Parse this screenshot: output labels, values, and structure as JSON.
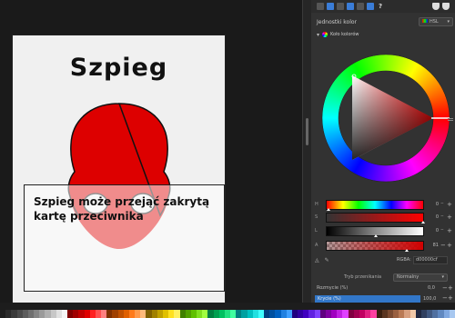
{
  "canvas": {
    "card_title": "Szpieg",
    "card_text": "Szpieg może przejąć zakrytą kartę przeciwnika",
    "spy_color": "#dd0000"
  },
  "dock": {
    "toolbar_icons": [
      "snap-icon",
      "layers-icon",
      "objects-icon",
      "symbols-icon",
      "color-icon",
      "swatches-icon",
      "help-icon",
      "shield-icon",
      "shield-icon"
    ],
    "toolbar_help": "?",
    "units_label": "Jednostki kolor",
    "units_select": "HSL",
    "wheel_header": "Koło kolorów",
    "sliders": [
      {
        "label": "H",
        "value": "0"
      },
      {
        "label": "S",
        "value": "0"
      },
      {
        "label": "L",
        "value": "0"
      },
      {
        "label": "A",
        "value": "81"
      }
    ],
    "rgba_label": "RGBA:",
    "rgba_value": "d00000cf",
    "blend_label": "Tryb przenikania",
    "blend_value": "Normalny",
    "blur_label": "Rozmycie (%)",
    "blur_value": "0,0",
    "opacity_label": "Krycie (%)",
    "opacity_value": "100,0",
    "opacity_fraction": 1.0
  },
  "palette_colors": [
    "#1e1e1e",
    "#2a2a2a",
    "#3a3a3a",
    "#4a4a4a",
    "#5c5c5c",
    "#707070",
    "#858585",
    "#9a9a9a",
    "#b0b0b0",
    "#c7c7c7",
    "#e0e0e0",
    "#f5f5f5",
    "#800000",
    "#a00000",
    "#c00000",
    "#e00000",
    "#ff2020",
    "#ff5050",
    "#ff8080",
    "#803000",
    "#a04000",
    "#c05000",
    "#e06000",
    "#ff7a1a",
    "#ff9a4a",
    "#ffba7a",
    "#806000",
    "#a08000",
    "#c0a000",
    "#e0c000",
    "#ffe020",
    "#fff060",
    "#408000",
    "#50a000",
    "#60c000",
    "#80e020",
    "#a0ff40",
    "#008040",
    "#00a050",
    "#00c060",
    "#20e080",
    "#40ffa0",
    "#008080",
    "#00a0a0",
    "#00c0c0",
    "#20e0e0",
    "#40ffff",
    "#004080",
    "#0050a0",
    "#0060c0",
    "#2080e0",
    "#40a0ff",
    "#200080",
    "#3000a0",
    "#4000c0",
    "#6020e0",
    "#8040ff",
    "#600080",
    "#8000a0",
    "#a000c0",
    "#c020e0",
    "#e040ff",
    "#800040",
    "#a00050",
    "#c00060",
    "#e02080",
    "#ff40a0",
    "#3a2010",
    "#5a3520",
    "#7a4a30",
    "#9a6040",
    "#ba7a55",
    "#d8a080",
    "#f0c8a8",
    "#202840",
    "#304060",
    "#405880",
    "#5070a0",
    "#6088c0",
    "#80a8e0",
    "#a8c8f0"
  ]
}
